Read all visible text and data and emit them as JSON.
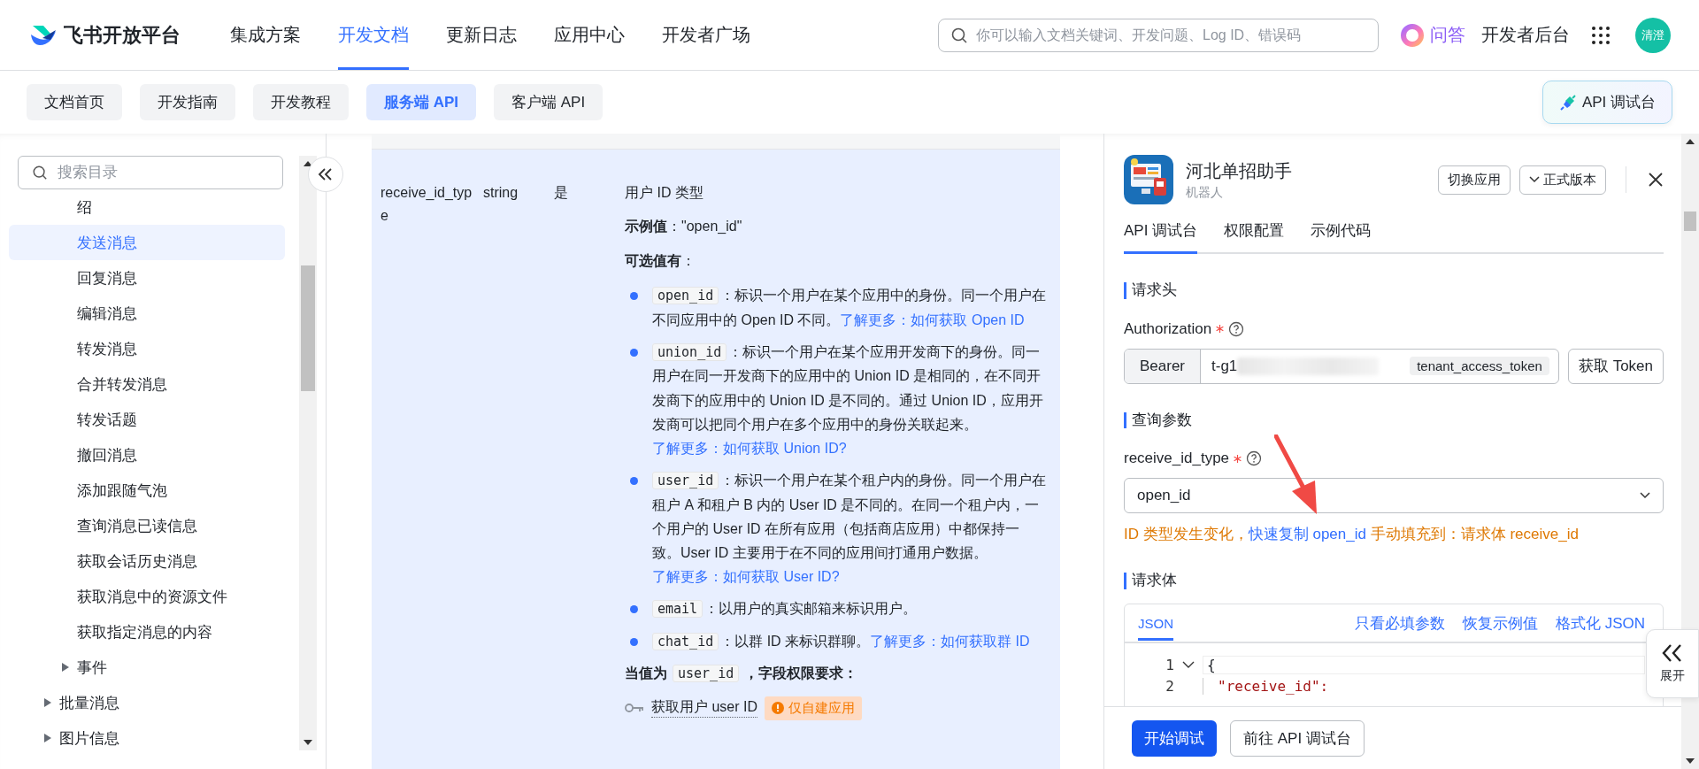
{
  "header": {
    "logo": "飞书开放平台",
    "nav": [
      {
        "label": "集成方案",
        "selected": false
      },
      {
        "label": "开发文档",
        "selected": true
      },
      {
        "label": "更新日志",
        "selected": false
      },
      {
        "label": "应用中心",
        "selected": false
      },
      {
        "label": "开发者广场",
        "selected": false
      }
    ],
    "search": {
      "placeholder": "你可以输入文档关键词、开发问题、Log ID、错误码"
    },
    "qa": "问答",
    "console_link": "开发者后台",
    "avatar": "清澄"
  },
  "subnav": {
    "tabs": [
      {
        "label": "文档首页",
        "selected": false
      },
      {
        "label": "开发指南",
        "selected": false
      },
      {
        "label": "开发教程",
        "selected": false
      },
      {
        "label": "服务端 API",
        "selected": true
      },
      {
        "label": "客户端 API",
        "selected": false
      }
    ],
    "api_console_button": "API 调试台"
  },
  "sidebar": {
    "search": {
      "placeholder": "搜索目录"
    },
    "tree": [
      {
        "children": [
          {
            "children": [
              {
                "label": "绍",
                "selected": false
              },
              {
                "label": "发送消息",
                "selected": true
              },
              {
                "label": "回复消息",
                "selected": false
              },
              {
                "label": "编辑消息",
                "selected": false
              },
              {
                "label": "转发消息",
                "selected": false
              },
              {
                "label": "合并转发消息",
                "selected": false
              },
              {
                "label": "转发话题",
                "selected": false
              },
              {
                "label": "撤回消息",
                "selected": false
              },
              {
                "label": "添加跟随气泡",
                "selected": false
              },
              {
                "label": "查询消息已读信息",
                "selected": false
              },
              {
                "label": "获取会话历史消息",
                "selected": false
              },
              {
                "label": "获取消息中的资源文件",
                "selected": false
              },
              {
                "label": "获取指定消息的内容",
                "selected": false
              }
            ]
          },
          {
            "label": "事件",
            "selected": false,
            "expanded": false
          }
        ]
      },
      {
        "label": "批量消息",
        "selected": false,
        "expanded": false
      },
      {
        "label": "图片信息",
        "selected": false,
        "expanded": false
      }
    ]
  },
  "param_table": {
    "rows": [
      {
        "name": "receive_id_type",
        "type": "string",
        "required": "是",
        "description": {
          "title": "用户 ID 类型",
          "example": "**示例值**：\"open_id\"",
          "options_heading": "**可选值有**：",
          "options": [
            {
              "code": "open_id",
              "text": "：标识一个用户在某个应用中的身份。同一个用户在不同应用中的 Open ID 不同。",
              "link": "了解更多：如何获取 Open ID"
            },
            {
              "code": "union_id",
              "text": "：标识一个用户在某个应用开发商下的身份。同一用户在同一开发商下的应用中的 Union ID 是相同的，在不同开发商下的应用中的 Union ID 是不同的。通过 Union ID，应用开发商可以把同个用户在多个应用中的身份关联起来。",
              "link": "了解更多：如何获取 Union ID?"
            },
            {
              "code": "user_id",
              "text": "：标识一个用户在某个租户内的身份。同一个用户在租户 A 和租户 B 内的 User ID 是不同的。在同一个租户内，一个用户的 User ID 在所有应用（包括商店应用）中都保持一致。User ID 主要用于在不同的应用间打通用户数据。",
              "link": "了解更多：如何获取 User ID?"
            },
            {
              "code": "email",
              "text": "：以用户的真实邮箱来标识用户。"
            },
            {
              "code": "chat_id",
              "text": "：以群 ID 来标识群聊。",
              "link": "了解更多：如何获取群 ID"
            }
          ],
          "permission_note": {
            "prefix": "当值为",
            "code": "user_id",
            "suffix": "，字段权限要求："
          },
          "permissions": [
            {
              "label": "获取用户 user ID",
              "badge": "仅自建应用"
            }
          ]
        }
      }
    ]
  },
  "debug_panel": {
    "app": {
      "name": "河北单招助手",
      "type": "机器人"
    },
    "switch_button": "切换应用",
    "version_button": "正式版本",
    "tabs": [
      {
        "label": "API 调试台",
        "selected": true
      },
      {
        "label": "权限配置",
        "selected": false
      },
      {
        "label": "示例代码",
        "selected": false
      }
    ],
    "headers_section": {
      "title": "请求头",
      "field_label": "Authorization",
      "required": true,
      "prefix": "Bearer",
      "token": "t-g1",
      "token_type": "tenant_access_token",
      "button": "获取 Token"
    },
    "query_section": {
      "title": "查询参数",
      "field_label": "receive_id_type",
      "required": true,
      "value": "open_id",
      "notice": {
        "before": "ID 类型发生变化，",
        "link": "快速复制 open_id",
        "after": " 手动填充到：请求体 receive_id"
      }
    },
    "body_section": {
      "title": "请求体",
      "tabs": [
        {
          "label": "JSON",
          "selected": true
        }
      ],
      "actions": [
        "只看必填参数",
        "恢复示例值",
        "格式化 JSON"
      ],
      "code_lines": [
        {
          "number": "1",
          "text": "{",
          "foldable": true
        },
        {
          "number": "2",
          "text": "\"receive_id\":",
          "foldable": false
        }
      ]
    },
    "footer": {
      "primary": "开始调试",
      "secondary": "前往 API 调试台"
    },
    "expand_button": "展开"
  }
}
